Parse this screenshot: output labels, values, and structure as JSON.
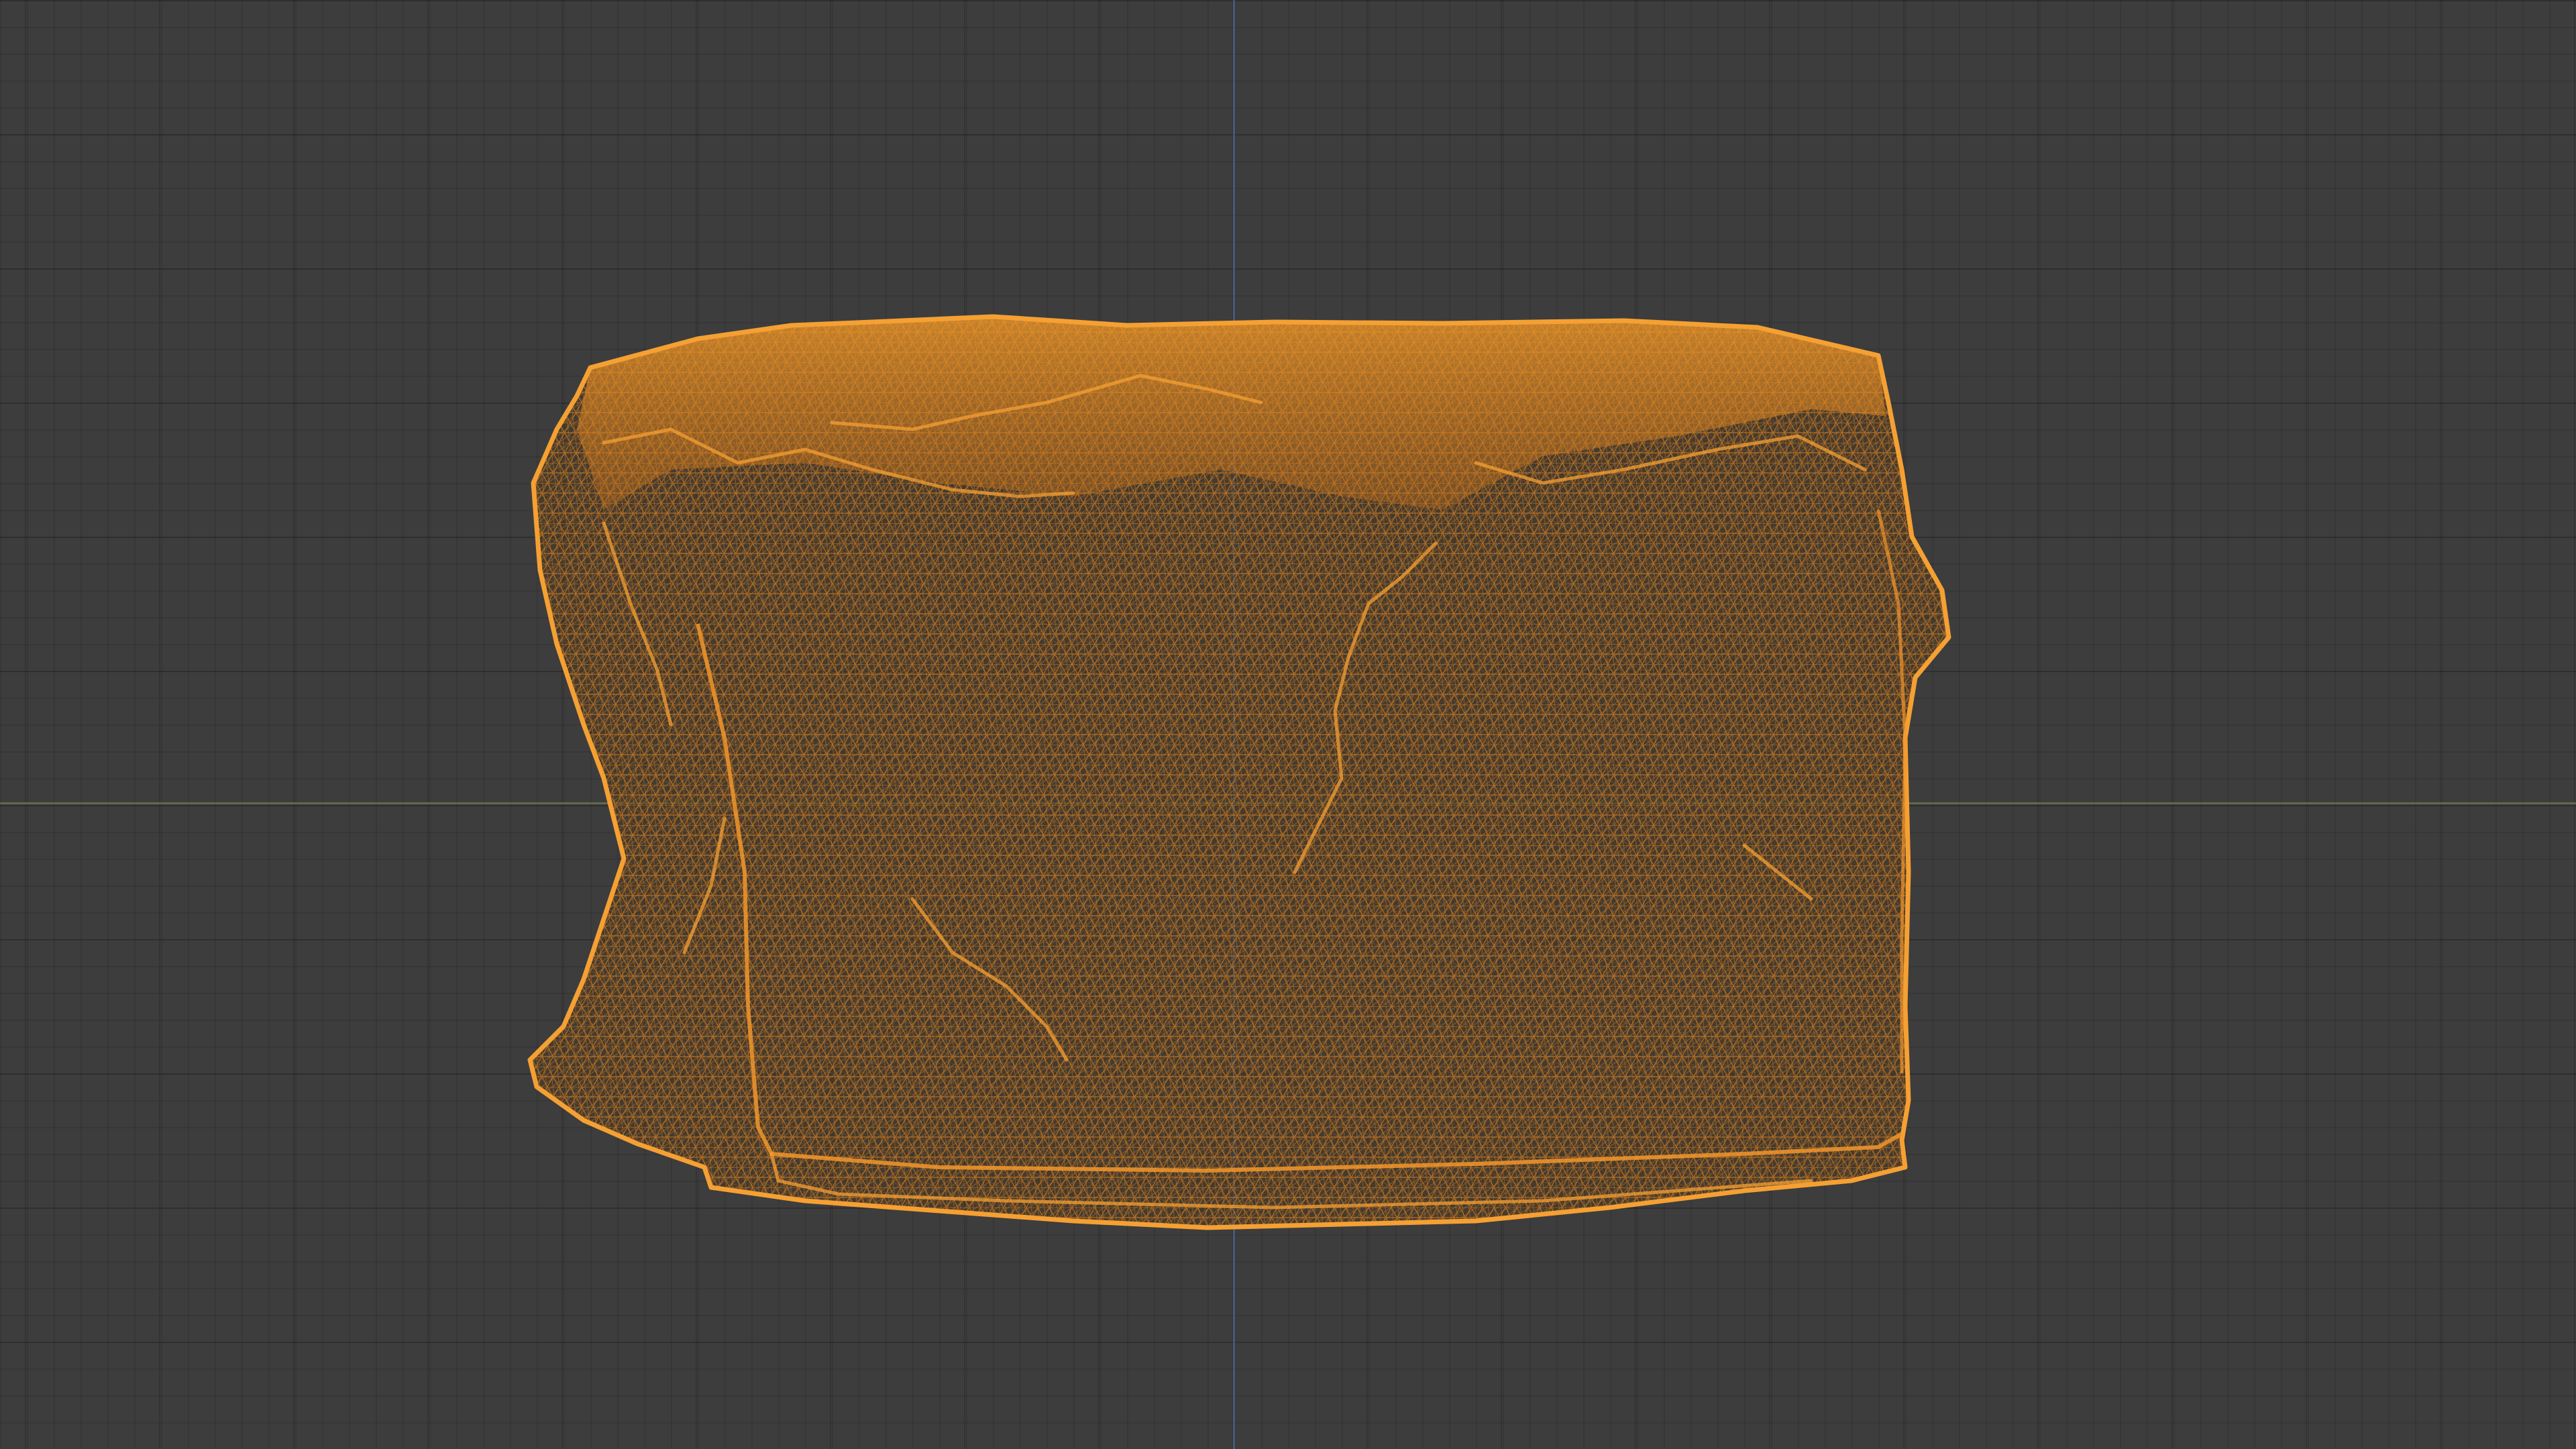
{
  "viewport": {
    "background_color": "#3d3d3d",
    "grid_color": "#353535",
    "x_axis_color": "#6d7a4e",
    "y_axis_color": "#4f6a8f"
  },
  "object": {
    "display": "wireframe",
    "selected": true,
    "wire_color": "#f08a1c"
  }
}
